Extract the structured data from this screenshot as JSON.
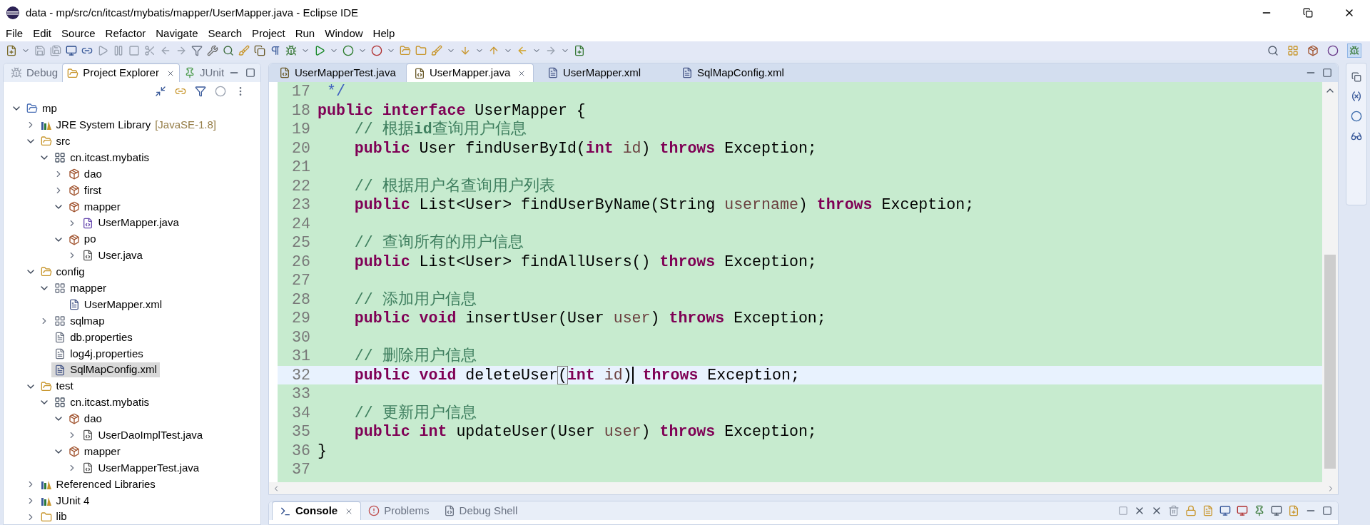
{
  "window": {
    "title": "data - mp/src/cn/itcast/mybatis/mapper/UserMapper.java - Eclipse IDE"
  },
  "menu": [
    "File",
    "Edit",
    "Source",
    "Refactor",
    "Navigate",
    "Search",
    "Project",
    "Run",
    "Window",
    "Help"
  ],
  "left_panel": {
    "tabs": [
      {
        "label": "Debug",
        "selected": false,
        "kind": "debug"
      },
      {
        "label": "Project Explorer",
        "selected": true,
        "kind": "explorer"
      },
      {
        "label": "JUnit",
        "selected": false,
        "kind": "junit"
      }
    ],
    "tree": [
      {
        "label": "mp",
        "kind": "project",
        "expanded": true,
        "selected": false,
        "children": [
          {
            "label": "JRE System Library",
            "decoration": "[JavaSE-1.8]",
            "kind": "library",
            "expanded": false,
            "selected": false
          },
          {
            "label": "src",
            "kind": "source-folder",
            "expanded": true,
            "selected": false,
            "children": [
              {
                "label": "cn.itcast.mybatis",
                "kind": "package-root",
                "expanded": true,
                "selected": false,
                "children": [
                  {
                    "label": "dao",
                    "kind": "package",
                    "expanded": false,
                    "selected": false
                  },
                  {
                    "label": "first",
                    "kind": "package",
                    "expanded": false,
                    "selected": false
                  },
                  {
                    "label": "mapper",
                    "kind": "package",
                    "expanded": true,
                    "selected": false,
                    "children": [
                      {
                        "label": "UserMapper.java",
                        "kind": "interface-file",
                        "expanded": false,
                        "selected": false
                      }
                    ]
                  },
                  {
                    "label": "po",
                    "kind": "package",
                    "expanded": true,
                    "selected": false,
                    "children": [
                      {
                        "label": "User.java",
                        "kind": "java-file",
                        "expanded": false,
                        "selected": false
                      }
                    ]
                  }
                ]
              }
            ]
          },
          {
            "label": "config",
            "kind": "source-folder",
            "expanded": true,
            "selected": false,
            "children": [
              {
                "label": "mapper",
                "kind": "folder-package",
                "expanded": true,
                "selected": false,
                "children": [
                  {
                    "label": "UserMapper.xml",
                    "kind": "xml-file",
                    "selected": false
                  }
                ]
              },
              {
                "label": "sqlmap",
                "kind": "folder-package",
                "expanded": false,
                "selected": false
              },
              {
                "label": "db.properties",
                "kind": "text-file",
                "selected": false
              },
              {
                "label": "log4j.properties",
                "kind": "text-file",
                "selected": false
              },
              {
                "label": "SqlMapConfig.xml",
                "kind": "xml-file",
                "selected": true
              }
            ]
          },
          {
            "label": "test",
            "kind": "source-folder",
            "expanded": true,
            "selected": false,
            "children": [
              {
                "label": "cn.itcast.mybatis",
                "kind": "package-root",
                "expanded": true,
                "selected": false,
                "children": [
                  {
                    "label": "dao",
                    "kind": "package",
                    "expanded": true,
                    "selected": false,
                    "children": [
                      {
                        "label": "UserDaoImplTest.java",
                        "kind": "java-file",
                        "expanded": false,
                        "selected": false
                      }
                    ]
                  },
                  {
                    "label": "mapper",
                    "kind": "package",
                    "expanded": true,
                    "selected": false,
                    "children": [
                      {
                        "label": "UserMapperTest.java",
                        "kind": "java-file",
                        "expanded": false,
                        "selected": false
                      }
                    ]
                  }
                ]
              }
            ]
          },
          {
            "label": "Referenced Libraries",
            "kind": "library",
            "expanded": false,
            "selected": false
          },
          {
            "label": "JUnit 4",
            "kind": "library",
            "expanded": false,
            "selected": false
          },
          {
            "label": "lib",
            "kind": "folder",
            "expanded": false,
            "selected": false
          }
        ]
      }
    ]
  },
  "editor": {
    "tabs": [
      {
        "label": "UserMapperTest.java",
        "kind": "java",
        "selected": false
      },
      {
        "label": "UserMapper.java",
        "kind": "java",
        "selected": true
      },
      {
        "label": "UserMapper.xml",
        "kind": "xml",
        "selected": false
      },
      {
        "label": "SqlMapConfig.xml",
        "kind": "xml",
        "selected": false
      }
    ],
    "lines": [
      {
        "number": "17",
        "current": false,
        "tokens": [
          {
            "text": " */",
            "kind": "javadoc"
          }
        ]
      },
      {
        "number": "18",
        "current": false,
        "tokens": [
          {
            "text": "public",
            "kind": "keyword"
          },
          {
            "text": " interface",
            "kind": "keyword"
          },
          {
            "text": " UserMapper {",
            "kind": "plain"
          }
        ]
      },
      {
        "number": "19",
        "current": false,
        "tokens": [
          {
            "text": "    // 根据",
            "kind": "comment"
          },
          {
            "text": "id",
            "kind": "comment-bold"
          },
          {
            "text": "查询用户信息",
            "kind": "comment"
          }
        ]
      },
      {
        "number": "20",
        "current": false,
        "tokens": [
          {
            "text": "    public",
            "kind": "keyword"
          },
          {
            "text": " User findUserById(",
            "kind": "plain"
          },
          {
            "text": "int",
            "kind": "keyword"
          },
          {
            "text": " id",
            "kind": "param"
          },
          {
            "text": ") ",
            "kind": "plain"
          },
          {
            "text": "throws",
            "kind": "keyword"
          },
          {
            "text": " Exception;",
            "kind": "plain"
          }
        ]
      },
      {
        "number": "21",
        "current": false
      },
      {
        "number": "22",
        "current": false,
        "tokens": [
          {
            "text": "    // 根据用户名查询用户列表",
            "kind": "comment"
          }
        ]
      },
      {
        "number": "23",
        "current": false,
        "tokens": [
          {
            "text": "    public",
            "kind": "keyword"
          },
          {
            "text": " List<User> findUserByName(String ",
            "kind": "plain"
          },
          {
            "text": "username",
            "kind": "param"
          },
          {
            "text": ") ",
            "kind": "plain"
          },
          {
            "text": "throws",
            "kind": "keyword"
          },
          {
            "text": " Exception;",
            "kind": "plain"
          }
        ]
      },
      {
        "number": "24",
        "current": false
      },
      {
        "number": "25",
        "current": false,
        "tokens": [
          {
            "text": "    // 查询所有的用户信息",
            "kind": "comment"
          }
        ]
      },
      {
        "number": "26",
        "current": false,
        "tokens": [
          {
            "text": "    public",
            "kind": "keyword"
          },
          {
            "text": " List<User> findAllUsers() ",
            "kind": "plain"
          },
          {
            "text": "throws",
            "kind": "keyword"
          },
          {
            "text": " Exception;",
            "kind": "plain"
          }
        ]
      },
      {
        "number": "27",
        "current": false
      },
      {
        "number": "28",
        "current": false,
        "tokens": [
          {
            "text": "    // 添加用户信息",
            "kind": "comment"
          }
        ]
      },
      {
        "number": "29",
        "current": false,
        "tokens": [
          {
            "text": "    public",
            "kind": "keyword"
          },
          {
            "text": " void",
            "kind": "keyword"
          },
          {
            "text": " insertUser(User ",
            "kind": "plain"
          },
          {
            "text": "user",
            "kind": "param"
          },
          {
            "text": ") ",
            "kind": "plain"
          },
          {
            "text": "throws",
            "kind": "keyword"
          },
          {
            "text": " Exception;",
            "kind": "plain"
          }
        ]
      },
      {
        "number": "30",
        "current": false
      },
      {
        "number": "31",
        "current": false,
        "tokens": [
          {
            "text": "    // 删除用户信息",
            "kind": "comment"
          }
        ]
      },
      {
        "number": "32",
        "current": true,
        "tokens": [
          {
            "text": "    public",
            "kind": "keyword"
          },
          {
            "text": " void",
            "kind": "keyword"
          },
          {
            "text": " deleteUser",
            "kind": "plain"
          },
          {
            "text": "(",
            "kind": "bracket-match"
          },
          {
            "text": "int",
            "kind": "keyword"
          },
          {
            "text": " id",
            "kind": "param"
          },
          {
            "text": ")",
            "kind": "caret"
          },
          {
            "text": " throws",
            "kind": "keyword"
          },
          {
            "text": " Exception;",
            "kind": "plain"
          }
        ]
      },
      {
        "number": "33",
        "current": false
      },
      {
        "number": "34",
        "current": false,
        "tokens": [
          {
            "text": "    // 更新用户信息",
            "kind": "comment"
          }
        ]
      },
      {
        "number": "35",
        "current": false,
        "tokens": [
          {
            "text": "    public",
            "kind": "keyword"
          },
          {
            "text": " int",
            "kind": "keyword"
          },
          {
            "text": " updateUser(User ",
            "kind": "plain"
          },
          {
            "text": "user",
            "kind": "param"
          },
          {
            "text": ") ",
            "kind": "plain"
          },
          {
            "text": "throws",
            "kind": "keyword"
          },
          {
            "text": " Exception;",
            "kind": "plain"
          }
        ]
      },
      {
        "number": "36",
        "current": false,
        "tokens": [
          {
            "text": "}",
            "kind": "plain"
          }
        ]
      },
      {
        "number": "37",
        "current": false
      }
    ]
  },
  "bottom_panel": {
    "tabs": [
      {
        "label": "Console",
        "kind": "console",
        "selected": true
      },
      {
        "label": "Problems",
        "kind": "problems",
        "selected": false
      },
      {
        "label": "Debug Shell",
        "kind": "shell",
        "selected": false
      }
    ]
  }
}
